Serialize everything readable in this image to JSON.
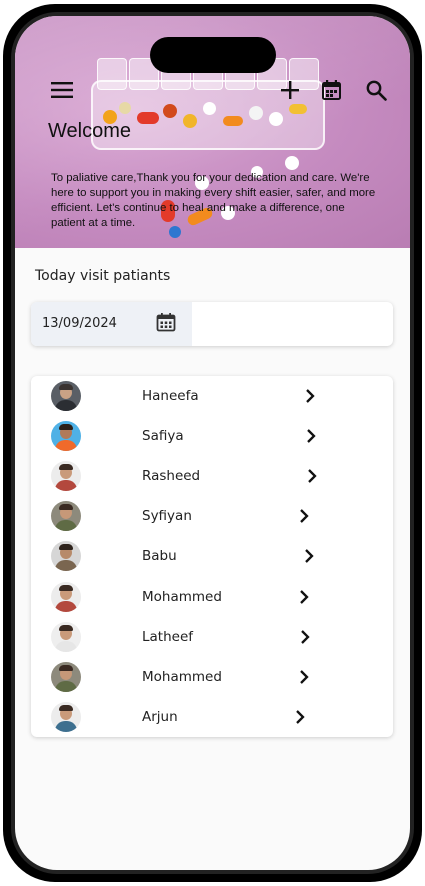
{
  "header": {
    "welcome": "Welcome",
    "message": "To paliative care,Thank you for your dedication and care. We're here to support you in making every shift easier, safer, and more efficient. Let's continue to heal and make a difference, one patient at a time.",
    "icons": [
      "menu-icon",
      "add-icon",
      "calendar-icon",
      "search-icon"
    ]
  },
  "visits": {
    "title": "Today visit patiants",
    "date": "13/09/2024"
  },
  "patients": [
    {
      "name": "Haneefa"
    },
    {
      "name": "Safiya"
    },
    {
      "name": "Rasheed"
    },
    {
      "name": "Syfiyan"
    },
    {
      "name": "Babu"
    },
    {
      "name": "Mohammed"
    },
    {
      "name": "Latheef"
    },
    {
      "name": "Mohammed"
    },
    {
      "name": "Arjun"
    }
  ],
  "colors": {
    "hero_bg": "#c58bc0",
    "date_field_bg": "#eef1f6",
    "card_bg": "#ffffff"
  }
}
